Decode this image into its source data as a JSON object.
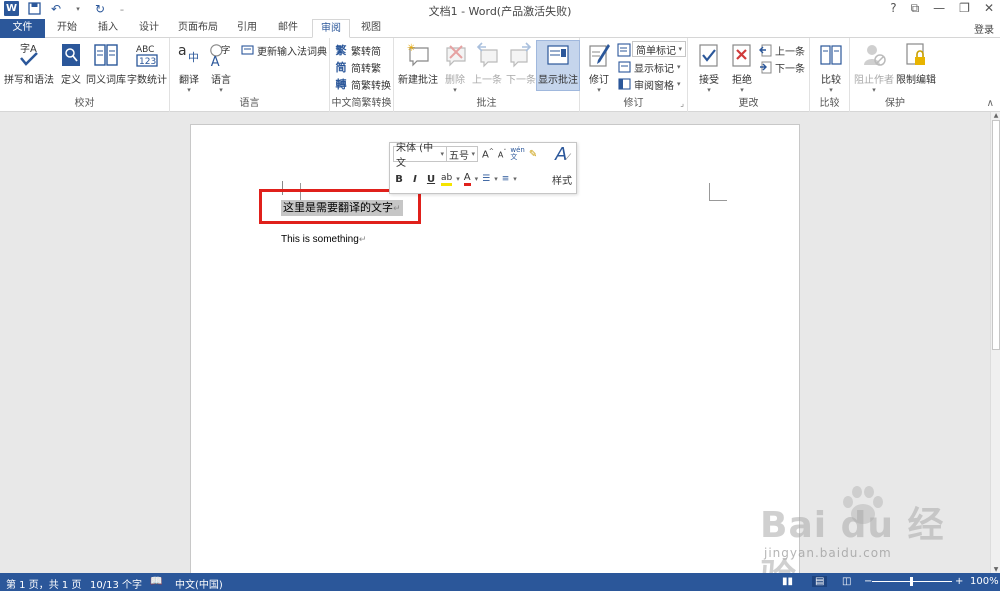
{
  "window": {
    "title": "文档1 - Word(产品激活失败)",
    "controls": [
      "?",
      "⧉",
      "—",
      "❐",
      "✕"
    ]
  },
  "tabs": [
    "文件",
    "开始",
    "插入",
    "设计",
    "页面布局",
    "引用",
    "邮件",
    "审阅",
    "视图"
  ],
  "active_tab": "审阅",
  "login": "登录",
  "ribbon": {
    "proofing": {
      "label": "校对",
      "spelling": "拼写和语法",
      "define": "定义",
      "thesaurus": "同义词库",
      "wordcount": "字数统计"
    },
    "language": {
      "label": "语言",
      "translate": "翻译",
      "language": "语言",
      "update_ime": "更新输入法词典"
    },
    "chinese": {
      "label": "中文简繁转换",
      "t2s": "繁转简",
      "s2t": "简转繁",
      "convert": "简繁转换"
    },
    "comments": {
      "label": "批注",
      "new": "新建批注",
      "delete": "删除",
      "prev": "上一条",
      "next": "下一条",
      "show": "显示批注"
    },
    "tracking": {
      "label": "修订",
      "track": "修订",
      "markup_combo": "简单标记",
      "show_markup": "显示标记",
      "reviewing_pane": "审阅窗格"
    },
    "changes": {
      "label": "更改",
      "accept": "接受",
      "reject": "拒绝",
      "prev": "上一条",
      "next": "下一条"
    },
    "compare": {
      "label": "比较",
      "compare": "比较"
    },
    "protect": {
      "label": "保护",
      "block": "阻止作者",
      "restrict": "限制编辑"
    }
  },
  "mini_toolbar": {
    "font": "宋体 (中文",
    "size": "五号",
    "styles": "样式"
  },
  "document": {
    "line1": "这里是需要翻译的文字",
    "line2": "This is something",
    "para_mark": "↵"
  },
  "watermark": {
    "brand": "Bai du 经验",
    "url": "jingyan.baidu.com"
  },
  "status": {
    "page": "第 1 页，共 1 页",
    "words": "10/13 个字",
    "lang": "中文(中国)",
    "zoom": "100%"
  },
  "colors": {
    "accent": "#2b579a",
    "highlight_box": "#e0201b"
  }
}
